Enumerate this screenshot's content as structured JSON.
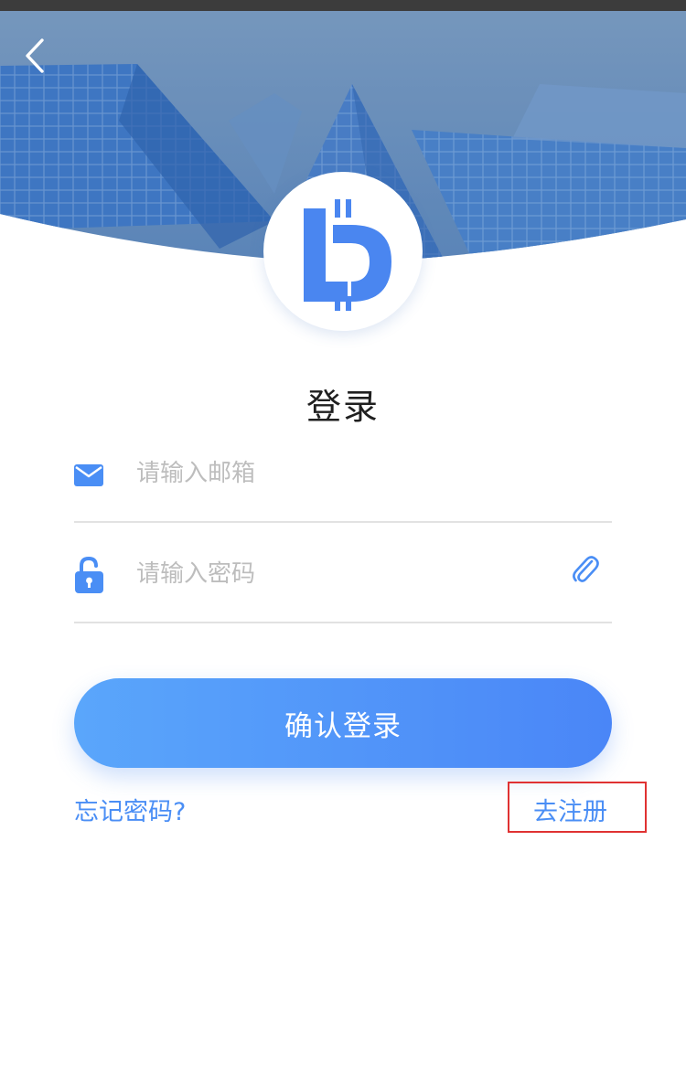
{
  "header": {
    "back_icon": "chevron-left-icon",
    "logo_icon": "bitcoin-d-logo-icon",
    "background": "city-buildings-photo"
  },
  "login": {
    "title": "登录",
    "email_icon": "envelope-icon",
    "email_placeholder": "请输入邮箱",
    "password_icon": "unlock-icon",
    "password_placeholder": "请输入密码",
    "password_action_icon": "paperclip-icon",
    "confirm_label": "确认登录",
    "forgot_label": "忘记密码?",
    "register_label": "去注册"
  },
  "colors": {
    "accent": "#4a8ef5",
    "button_start": "#5aa6fb",
    "button_end": "#4a86f7",
    "highlight_box": "#e03232"
  }
}
